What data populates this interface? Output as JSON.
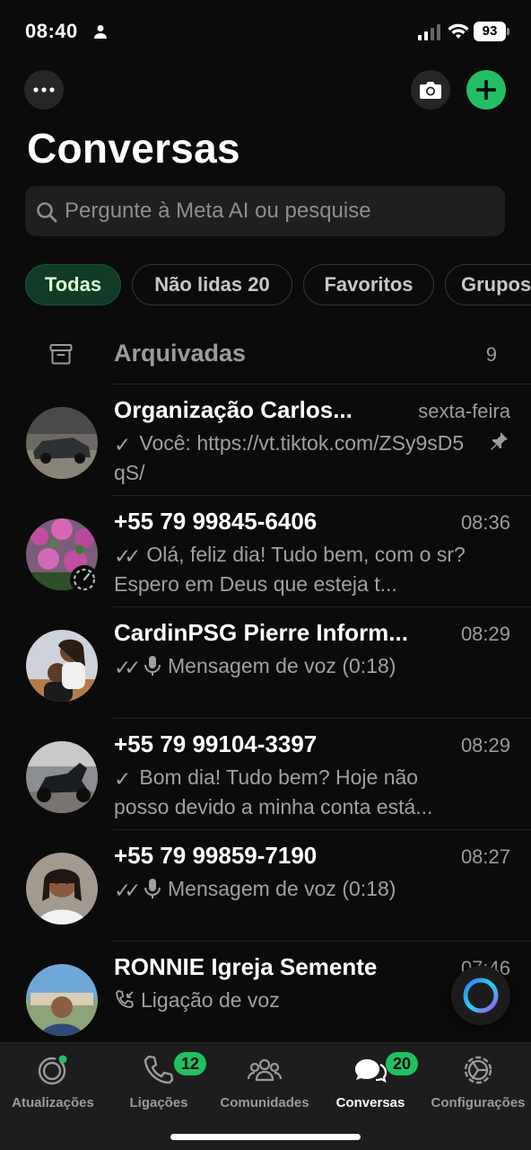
{
  "status_bar": {
    "time": "08:40",
    "battery": "93"
  },
  "header": {
    "title": "Conversas"
  },
  "search": {
    "placeholder": "Pergunte à Meta AI ou pesquise"
  },
  "filters": [
    {
      "label": "Todas",
      "active": true
    },
    {
      "label": "Não lidas 20",
      "active": false
    },
    {
      "label": "Favoritos",
      "active": false
    },
    {
      "label": "Grupos",
      "active": false
    }
  ],
  "archived": {
    "label": "Arquivadas",
    "count": "9"
  },
  "chats": [
    {
      "name": "Organização Carlos...",
      "time": "sexta-feira",
      "tick": "✓",
      "preview": "Você: https://vt.tiktok.com/ZSy9sD5qS/",
      "pinned": true
    },
    {
      "name": "+55 79 99845-6406",
      "time": "08:36",
      "tick": "✓✓",
      "preview": "Olá, feliz dia! Tudo bem, com o sr? Espero em Deus que esteja t...",
      "pinned": false
    },
    {
      "name": "CardinPSG Pierre Inform...",
      "time": "08:29",
      "tick": "✓✓",
      "preview": "Mensagem de voz (0:18)",
      "pinned": false
    },
    {
      "name": "+55 79 99104-3397",
      "time": "08:29",
      "tick": "✓",
      "preview": "Bom dia! Tudo bem? Hoje não posso devido a minha conta está...",
      "pinned": false
    },
    {
      "name": "+55 79 99859-7190",
      "time": "08:27",
      "tick": "✓✓",
      "preview": "Mensagem de voz (0:18)",
      "pinned": false
    },
    {
      "name": "RONNIE Igreja Semente",
      "time": "07:46",
      "tick": "",
      "preview": "Ligação de voz",
      "pinned": false
    }
  ],
  "tabs": [
    {
      "label": "Atualizações",
      "icon": "updates-icon",
      "badge": ""
    },
    {
      "label": "Ligações",
      "icon": "phone-icon",
      "badge": "12"
    },
    {
      "label": "Comunidades",
      "icon": "communities-icon",
      "badge": ""
    },
    {
      "label": "Conversas",
      "icon": "chats-icon",
      "badge": "20"
    },
    {
      "label": "Configurações",
      "icon": "settings-icon",
      "badge": ""
    }
  ],
  "colors": {
    "accent": "#21c063",
    "background": "#0b0b0b",
    "chip_active": "#103b26"
  }
}
